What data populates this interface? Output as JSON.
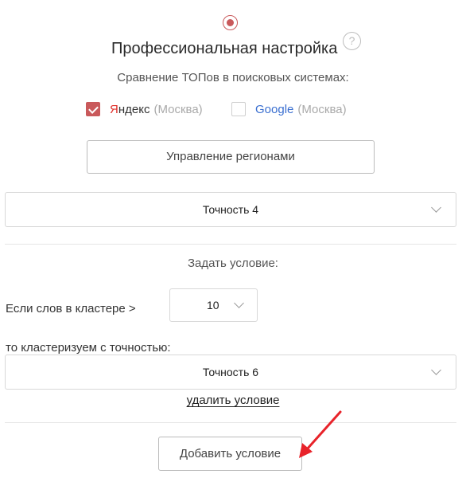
{
  "header": {
    "mode_radio": "selected",
    "title": "Профессиональная настройка",
    "help_icon": "?"
  },
  "comparison": {
    "subtitle": "Сравнение ТОПов в поисковых системах:",
    "engines": [
      {
        "brand_first": "Я",
        "brand_rest": "ндекс",
        "region": "(Москва)",
        "checked": true
      },
      {
        "brand": "Google",
        "region": "(Москва)",
        "checked": false
      }
    ]
  },
  "regions_button": "Управление регионами",
  "precision_select": {
    "value": "Точность 4"
  },
  "condition": {
    "title": "Задать условие:",
    "if_label": "Если слов в кластере >",
    "word_count_select": "10",
    "precision_label": "то кластеризуем с точностью:",
    "precision_select": "Точность 6",
    "delete_link": "удалить условие"
  },
  "add_condition_button": "Добавить условие",
  "colors": {
    "accent": "#c9595b",
    "yandex_red": "#e0312c",
    "google_blue": "#3a6fd0",
    "annotation_arrow": "#e8232a"
  },
  "icons": [
    "radio-selected-icon",
    "help-icon",
    "checkbox-checked-icon",
    "checkbox-unchecked-icon",
    "chevron-down-icon",
    "annotation-arrow-icon"
  ]
}
